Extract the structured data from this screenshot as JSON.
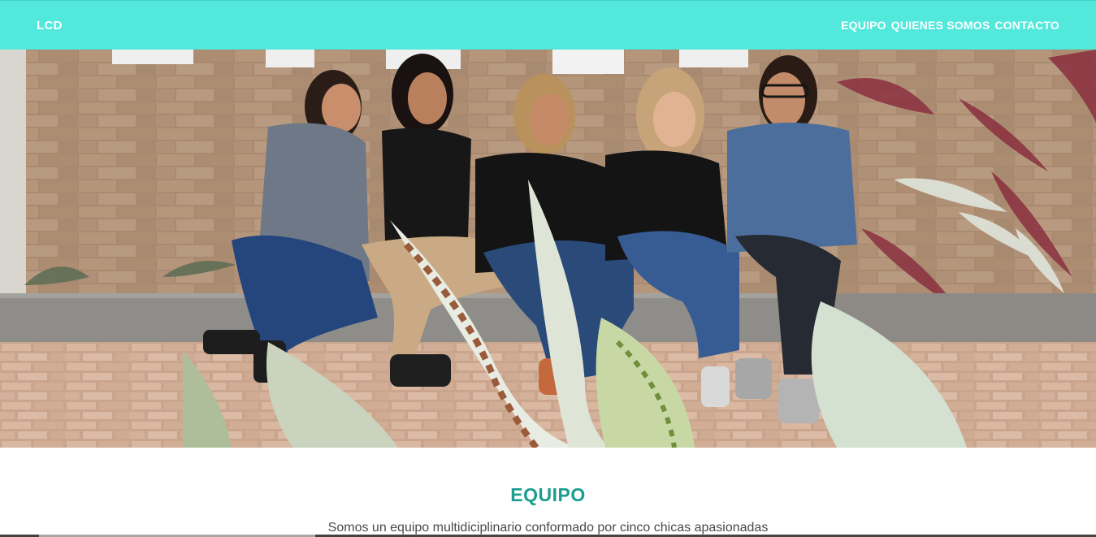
{
  "header": {
    "logo": "LCD",
    "nav": [
      {
        "label": "EQUIPO"
      },
      {
        "label": "QUIENES SOMOS"
      },
      {
        "label": "CONTACTO"
      }
    ]
  },
  "hero": {
    "image": "team-photo"
  },
  "section": {
    "title": "EQUIPO",
    "text": "Somos un equipo multidiciplinario conformado por cinco chicas apasionadas"
  },
  "colors": {
    "header_bg": "#52e8dc",
    "title_color": "#1a9e8f"
  }
}
